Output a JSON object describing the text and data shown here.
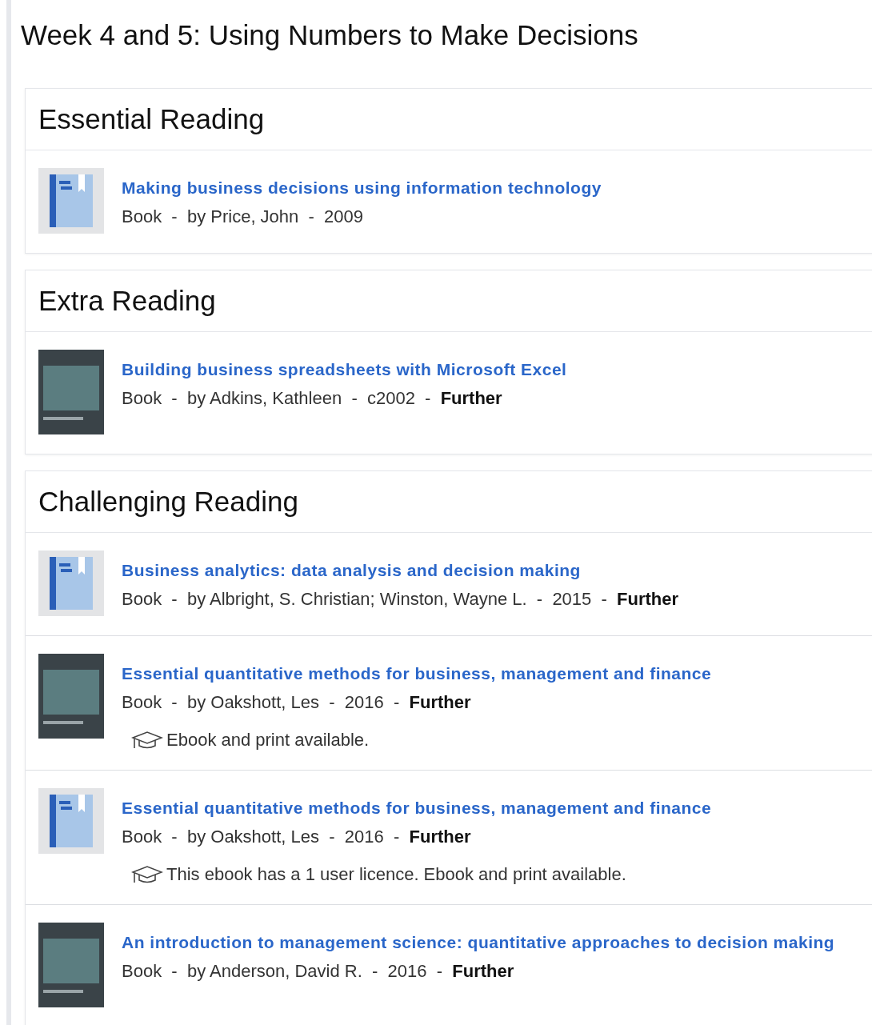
{
  "title": "Week 4 and 5: Using Numbers to Make Decisions",
  "sections": [
    {
      "heading": "Essential Reading",
      "items": [
        {
          "kind": "generic",
          "title": "Making business decisions using information technology",
          "meta": "Book  -  by Price, John  -  2009"
        }
      ]
    },
    {
      "heading": "Extra Reading",
      "items": [
        {
          "kind": "cover",
          "title": "Building business spreadsheets with Microsoft Excel",
          "meta": "Book  -  by Adkins, Kathleen  -  c2002  -  **Further**"
        }
      ]
    },
    {
      "heading": "Challenging Reading",
      "items": [
        {
          "kind": "generic",
          "title": "Business analytics: data analysis and decision making",
          "meta": "Book  -  by Albright, S. Christian; Winston, Wayne L.  -  2015  -  **Further**"
        },
        {
          "kind": "cover",
          "title": "Essential quantitative methods for business, management and finance",
          "meta": "Book  -  by Oakshott, Les  -  2016  -  **Further**",
          "note": "Ebook and print available."
        },
        {
          "kind": "generic",
          "title": "Essential quantitative methods for business, management and finance",
          "meta": "Book  -  by Oakshott, Les  -  2016  -  **Further**",
          "note": "This ebook has a 1 user licence. Ebook and print available."
        },
        {
          "kind": "cover",
          "title": "An introduction to management science: quantitative approaches to decision making",
          "meta": "Book  -  by Anderson, David R.  -  2016  -  **Further**"
        }
      ]
    }
  ]
}
